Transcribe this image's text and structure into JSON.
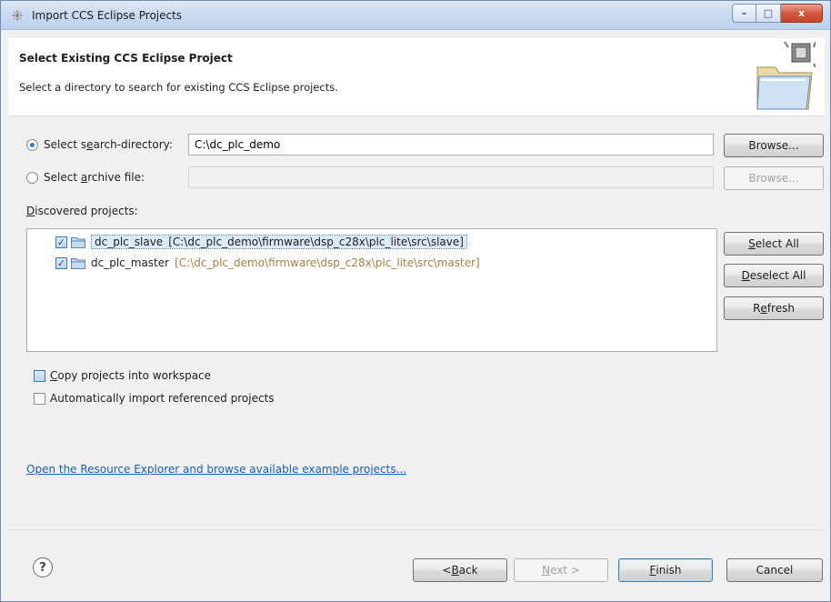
{
  "window": {
    "title": "Import CCS Eclipse Projects",
    "caption": {
      "minimize": "–",
      "maximize": "□",
      "close": "x"
    }
  },
  "banner": {
    "title": "Select Existing CCS Eclipse Project",
    "description": "Select a directory to search for existing CCS Eclipse projects."
  },
  "source": {
    "search_dir": {
      "label_pre": "Select s",
      "label_u": "e",
      "label_post": "arch-directory:",
      "checked": true,
      "value": "C:\\dc_plc_demo"
    },
    "archive": {
      "label_pre": "Select ",
      "label_u": "a",
      "label_post": "rchive file:",
      "checked": false,
      "value": ""
    },
    "browse_label": "Browse...",
    "browse_disabled_label": "Browse..."
  },
  "projects": {
    "label_u": "D",
    "label_rest": "iscovered projects:",
    "items": [
      {
        "name": "dc_plc_slave",
        "path": "[C:\\dc_plc_demo\\firmware\\dsp_c28x\\plc_lite\\src\\slave]",
        "checked": true,
        "selected": true
      },
      {
        "name": "dc_plc_master",
        "path": "[C:\\dc_plc_demo\\firmware\\dsp_c28x\\plc_lite\\src\\master]",
        "checked": true,
        "selected": false
      }
    ],
    "select_all": {
      "u": "S",
      "rest": "elect All"
    },
    "deselect_all": {
      "u": "D",
      "rest": "eselect All"
    },
    "refresh": {
      "pre": "R",
      "u": "e",
      "rest": "fresh"
    }
  },
  "options": {
    "copy": {
      "u": "C",
      "rest": "opy projects into workspace",
      "checked": false
    },
    "auto_import": {
      "text": "Automatically import referenced projects",
      "checked": false
    }
  },
  "link_text": "Open the Resource Explorer and browse available example projects...",
  "footer": {
    "help": "?",
    "back": {
      "pre": "< ",
      "u": "B",
      "rest": "ack"
    },
    "next": {
      "u": "N",
      "rest": "ext >"
    },
    "finish": {
      "u": "F",
      "rest": "inish"
    },
    "cancel": "Cancel"
  }
}
